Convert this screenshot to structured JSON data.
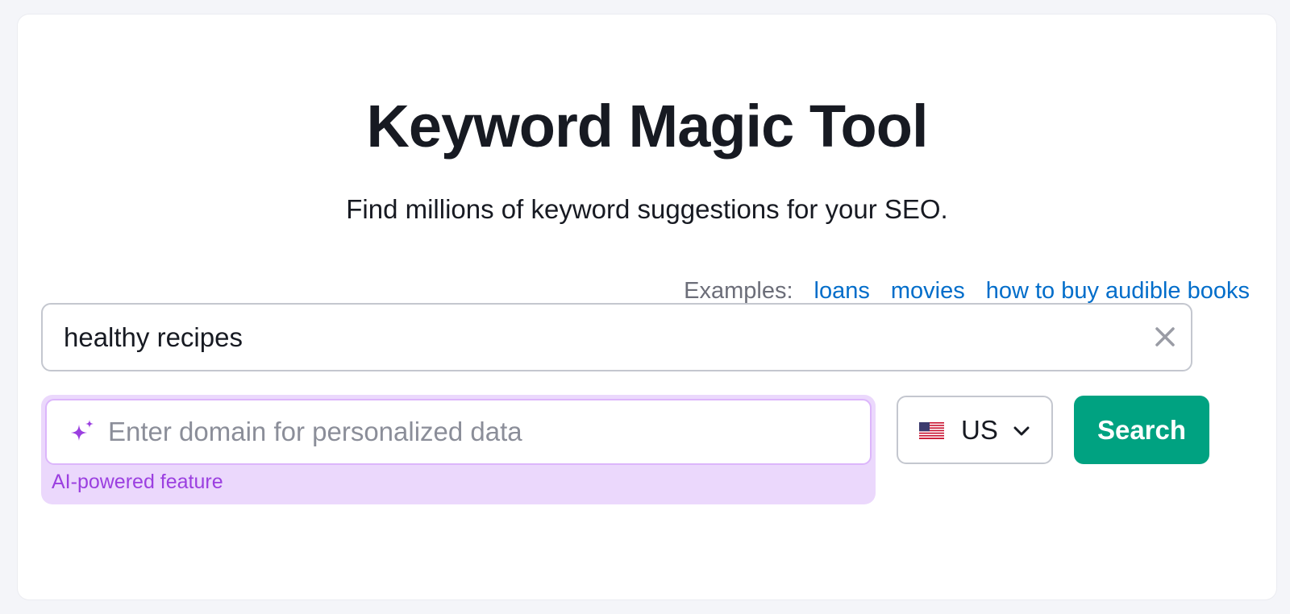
{
  "header": {
    "title": "Keyword Magic Tool",
    "subtitle": "Find millions of keyword suggestions for your SEO."
  },
  "examples": {
    "label": "Examples:",
    "items": [
      "loans",
      "movies",
      "how to buy audible books"
    ]
  },
  "keyword_input": {
    "value": "healthy recipes",
    "clear_icon": "close-icon"
  },
  "domain_input": {
    "placeholder": "Enter domain for personalized data",
    "icon": "sparkle-icon",
    "feature_label": "AI-powered feature"
  },
  "country_select": {
    "selected": "US",
    "icon": "us-flag-icon"
  },
  "search_button": {
    "label": "Search"
  },
  "colors": {
    "accent": "#00a281",
    "link": "#006dca",
    "ai": "#9b3fe0",
    "ai_bg": "#ebd8fc"
  }
}
